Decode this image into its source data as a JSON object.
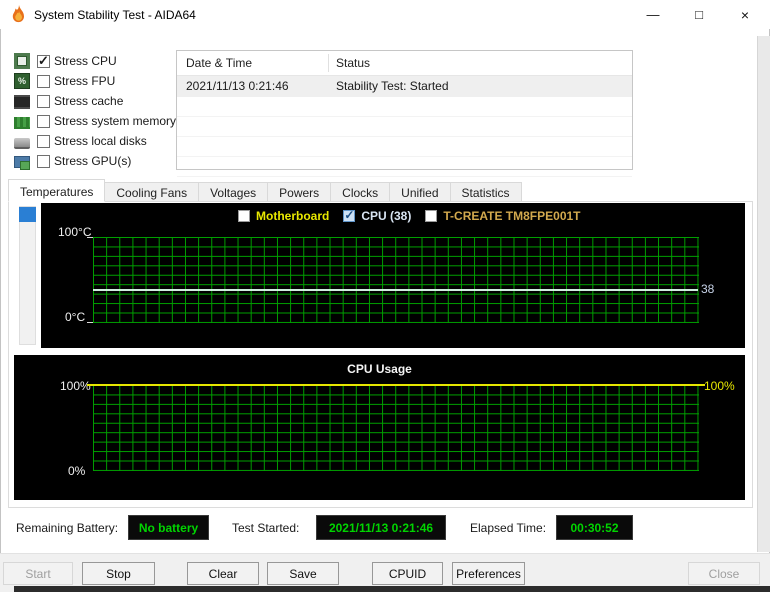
{
  "window_title": "System Stability Test - AIDA64",
  "titlebar": {
    "minimize_glyph": "—",
    "maximize_glyph": "□",
    "close_glyph": "×"
  },
  "stress_options": [
    {
      "label": "Stress CPU",
      "checked": true,
      "icon": "cpu-icon"
    },
    {
      "label": "Stress FPU",
      "checked": false,
      "icon": "fpu-icon"
    },
    {
      "label": "Stress cache",
      "checked": false,
      "icon": "cache-icon"
    },
    {
      "label": "Stress system memory",
      "checked": false,
      "icon": "ram-icon"
    },
    {
      "label": "Stress local disks",
      "checked": false,
      "icon": "disk-icon"
    },
    {
      "label": "Stress GPU(s)",
      "checked": false,
      "icon": "gpu-icon"
    }
  ],
  "fpu_icon_glyph": "%",
  "check_glyph": "✓",
  "events_table": {
    "columns": [
      "Date & Time",
      "Status"
    ],
    "rows": [
      {
        "datetime": "2021/11/13 0:21:46",
        "status": "Stability Test: Started"
      }
    ]
  },
  "tabs": [
    "Temperatures",
    "Cooling Fans",
    "Voltages",
    "Powers",
    "Clocks",
    "Unified",
    "Statistics"
  ],
  "active_tab": "Temperatures",
  "charts": [
    {
      "type": "line",
      "name": "temperatures",
      "y_top_label": "100°C",
      "y_bottom_label": "0°C",
      "ylim": [
        0,
        100
      ],
      "grid": true,
      "grid_color": "#00a000",
      "legend": [
        {
          "label": "Motherboard",
          "checked": false,
          "color": "#e8e800"
        },
        {
          "label": "CPU (38)",
          "checked": true,
          "color": "#d8e4f2"
        },
        {
          "label": "T-CREATE TM8FPE001T",
          "checked": false,
          "color": "#d2a94e"
        }
      ],
      "series": [
        {
          "name": "CPU",
          "current_value": 38,
          "shape": "flat line at 38°C across full width"
        }
      ],
      "value_label": "38"
    },
    {
      "type": "line",
      "name": "cpu-usage",
      "title": "CPU Usage",
      "y_top_label": "100%",
      "y_bottom_label": "0%",
      "right_value_label": "100%",
      "ylim": [
        0,
        100
      ],
      "grid": true,
      "grid_color": "#00a000",
      "line_color": "#e6e600",
      "series": [
        {
          "name": "CPU Usage",
          "current_value": 100,
          "shape": "flat line at 100% across full width"
        }
      ]
    }
  ],
  "status_bar": {
    "battery_label": "Remaining Battery:",
    "battery_value": "No battery",
    "test_started_label": "Test Started:",
    "test_started_value": "2021/11/13 0:21:46",
    "elapsed_label": "Elapsed Time:",
    "elapsed_value": "00:30:52",
    "value_color": "#00d400"
  },
  "buttons": [
    {
      "label": "Start",
      "enabled": false
    },
    {
      "label": "Stop",
      "enabled": true
    },
    {
      "label": "Clear",
      "enabled": true
    },
    {
      "label": "Save",
      "enabled": true
    },
    {
      "label": "CPUID",
      "enabled": true
    },
    {
      "label": "Preferences",
      "enabled": true
    },
    {
      "label": "Close",
      "enabled": false
    }
  ]
}
